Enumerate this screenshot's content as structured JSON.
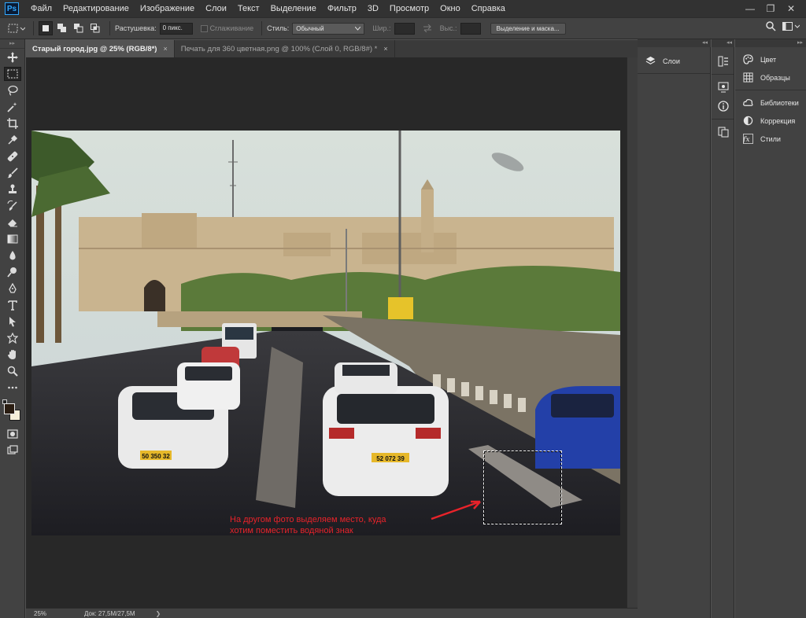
{
  "app": {
    "logo": "Ps"
  },
  "menu": [
    "Файл",
    "Редактирование",
    "Изображение",
    "Слои",
    "Текст",
    "Выделение",
    "Фильтр",
    "3D",
    "Просмотр",
    "Окно",
    "Справка"
  ],
  "window_controls": [
    "—",
    "❐",
    "✕"
  ],
  "options": {
    "feather_label": "Растушевка:",
    "feather_value": "0 пикс.",
    "antialias_label": "Сглаживание",
    "style_label": "Стиль:",
    "style_value": "Обычный",
    "width_label": "Шир.:",
    "height_label": "Выс.:",
    "select_mask_button": "Выделение и маска..."
  },
  "tabs": [
    {
      "label": "Старый город.jpg @ 25% (RGB/8*)",
      "active": true
    },
    {
      "label": "Печать для 360 цветная.png @ 100% (Слой 0, RGB/8#) *",
      "active": false
    }
  ],
  "tab_close": "×",
  "status": {
    "zoom": "25%",
    "doc_size": "Док: 27,5M/27,5M",
    "arrow": "❯"
  },
  "annotation": {
    "line1": "На другом фото выделяем место, куда",
    "line2": "хотим поместить водяной знак",
    "color": "#e8232a"
  },
  "photo_plates": {
    "left": "50 350 32",
    "center": "52 072 39"
  },
  "panels": {
    "layers": "Слои",
    "right": [
      {
        "label": "Цвет",
        "icon": "palette-icon"
      },
      {
        "label": "Образцы",
        "icon": "grid-icon"
      },
      {
        "label": "Библиотеки",
        "icon": "cloud-icon"
      },
      {
        "label": "Коррекция",
        "icon": "half-circle-icon"
      },
      {
        "label": "Стили",
        "icon": "fx-icon"
      }
    ]
  },
  "colors": {
    "foreground": "#2a1d12",
    "background": "#f6efd9",
    "chrome": "#424242",
    "menubar": "#323232"
  }
}
